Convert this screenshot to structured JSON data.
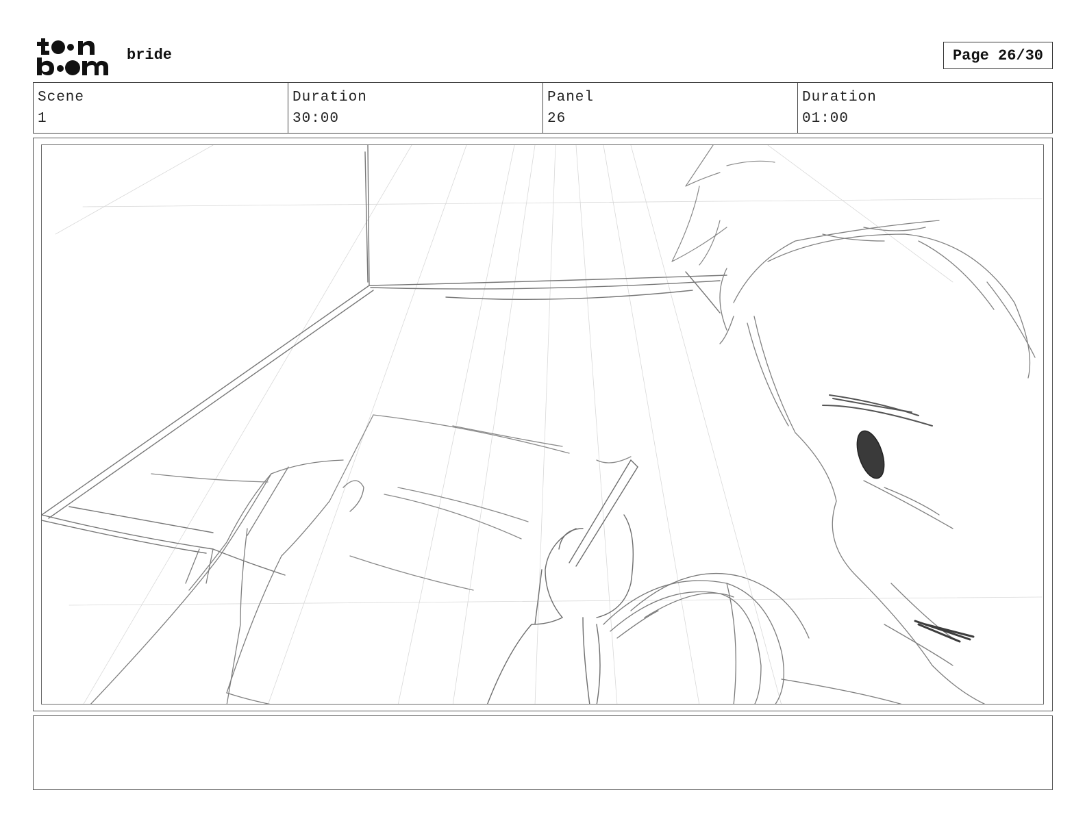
{
  "header": {
    "logo_top": "t●●n",
    "logo_bottom": "b●●m",
    "project_name": "bride",
    "page_indicator": "Page 26/30"
  },
  "info": {
    "scene_label": "Scene",
    "scene_value": "1",
    "scene_duration_label": "Duration",
    "scene_duration_value": "30:00",
    "panel_label": "Panel",
    "panel_value": "26",
    "panel_duration_label": "Duration",
    "panel_duration_value": "01:00"
  },
  "panel": {
    "image": "pencil-sketch-character-writing-at-desk-icon"
  },
  "notes": {
    "text": ""
  }
}
